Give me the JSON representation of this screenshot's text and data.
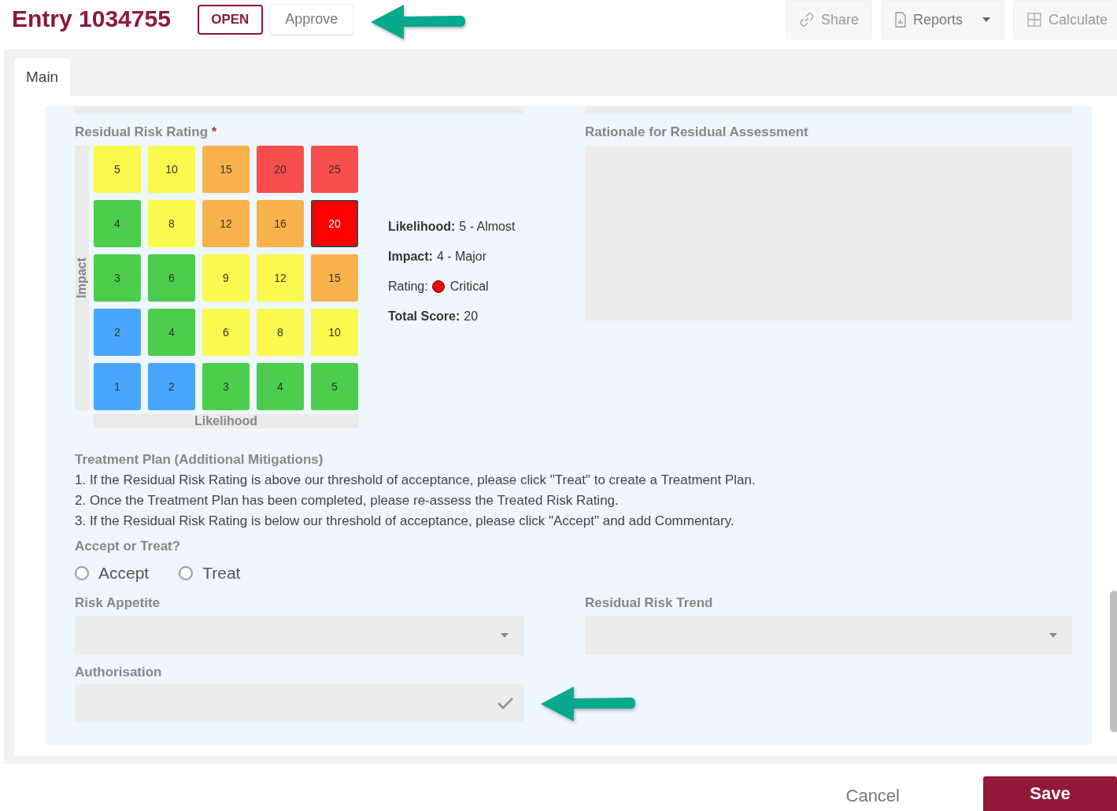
{
  "header": {
    "title": "Entry 1034755",
    "status": "OPEN",
    "approve": "Approve",
    "actions": [
      {
        "label": "Share",
        "kind": "link",
        "dropdown": false
      },
      {
        "label": "Reports",
        "kind": "file",
        "dropdown": true
      },
      {
        "label": "Calculate",
        "kind": "grid",
        "dropdown": false
      }
    ]
  },
  "tabs": [
    {
      "label": "Main",
      "selected": true
    }
  ],
  "risk_rating": {
    "label": "Residual Risk Rating",
    "required": "*",
    "axis_y": "Impact",
    "axis_x": "Likelihood",
    "matrix": [
      [
        {
          "value": "5",
          "color": "#f9f94e",
          "selected": false
        },
        {
          "value": "10",
          "color": "#f9f94e",
          "selected": false
        },
        {
          "value": "15",
          "color": "#f8b24c",
          "selected": false
        },
        {
          "value": "20",
          "color": "#f74d4d",
          "selected": false
        },
        {
          "value": "25",
          "color": "#f74d4d",
          "selected": false
        }
      ],
      [
        {
          "value": "4",
          "color": "#4ccd4e",
          "selected": false
        },
        {
          "value": "8",
          "color": "#f9f94e",
          "selected": false
        },
        {
          "value": "12",
          "color": "#f8b24c",
          "selected": false
        },
        {
          "value": "16",
          "color": "#f8b24c",
          "selected": false
        },
        {
          "value": "20",
          "color": "#ff0000",
          "selected": true
        }
      ],
      [
        {
          "value": "3",
          "color": "#4ccd4e",
          "selected": false
        },
        {
          "value": "6",
          "color": "#4ccd4e",
          "selected": false
        },
        {
          "value": "9",
          "color": "#f9f94e",
          "selected": false
        },
        {
          "value": "12",
          "color": "#f9f94e",
          "selected": false
        },
        {
          "value": "15",
          "color": "#f8b24c",
          "selected": false
        }
      ],
      [
        {
          "value": "2",
          "color": "#4aa6fd",
          "selected": false
        },
        {
          "value": "4",
          "color": "#4ccd4e",
          "selected": false
        },
        {
          "value": "6",
          "color": "#f9f94e",
          "selected": false
        },
        {
          "value": "8",
          "color": "#f9f94e",
          "selected": false
        },
        {
          "value": "10",
          "color": "#f9f94e",
          "selected": false
        }
      ],
      [
        {
          "value": "1",
          "color": "#4aa6fd",
          "selected": false
        },
        {
          "value": "2",
          "color": "#4aa6fd",
          "selected": false
        },
        {
          "value": "3",
          "color": "#4ccd4e",
          "selected": false
        },
        {
          "value": "4",
          "color": "#4ccd4e",
          "selected": false
        },
        {
          "value": "5",
          "color": "#4ccd4e",
          "selected": false
        }
      ]
    ],
    "summary": [
      {
        "kind": "text",
        "label": "Likelihood:",
        "value": "5 - Almost"
      },
      {
        "kind": "text",
        "label": "Impact:",
        "value": "4 - Major"
      },
      {
        "kind": "dot",
        "label": "Rating:",
        "value": "Critical",
        "color": "#ff0000"
      },
      {
        "kind": "text",
        "label": "Total Score:",
        "value": "20"
      }
    ]
  },
  "rationale": {
    "label": "Rationale for Residual Assessment"
  },
  "treatment": {
    "label": "Treatment Plan (Additional Mitigations)",
    "lines": [
      "1. If the Residual Risk Rating is above our threshold of acceptance, please click \"Treat\" to create a Treatment Plan.",
      "2. Once the Treatment Plan has been completed, please re-assess the Treated Risk Rating.",
      "3. If the Residual Risk Rating is below our threshold of acceptance, please click \"Accept\" and add Commentary."
    ]
  },
  "accept_or_treat": {
    "label": "Accept or Treat?",
    "options": [
      {
        "label": "Accept",
        "selected": false
      },
      {
        "label": "Treat",
        "selected": false
      }
    ]
  },
  "risk_appetite": {
    "label": "Risk Appetite"
  },
  "residual_risk_trend": {
    "label": "Residual Risk Trend"
  },
  "authorisation": {
    "label": "Authorisation",
    "checked": false
  },
  "footer": {
    "cancel": "Cancel",
    "save": "Save"
  }
}
